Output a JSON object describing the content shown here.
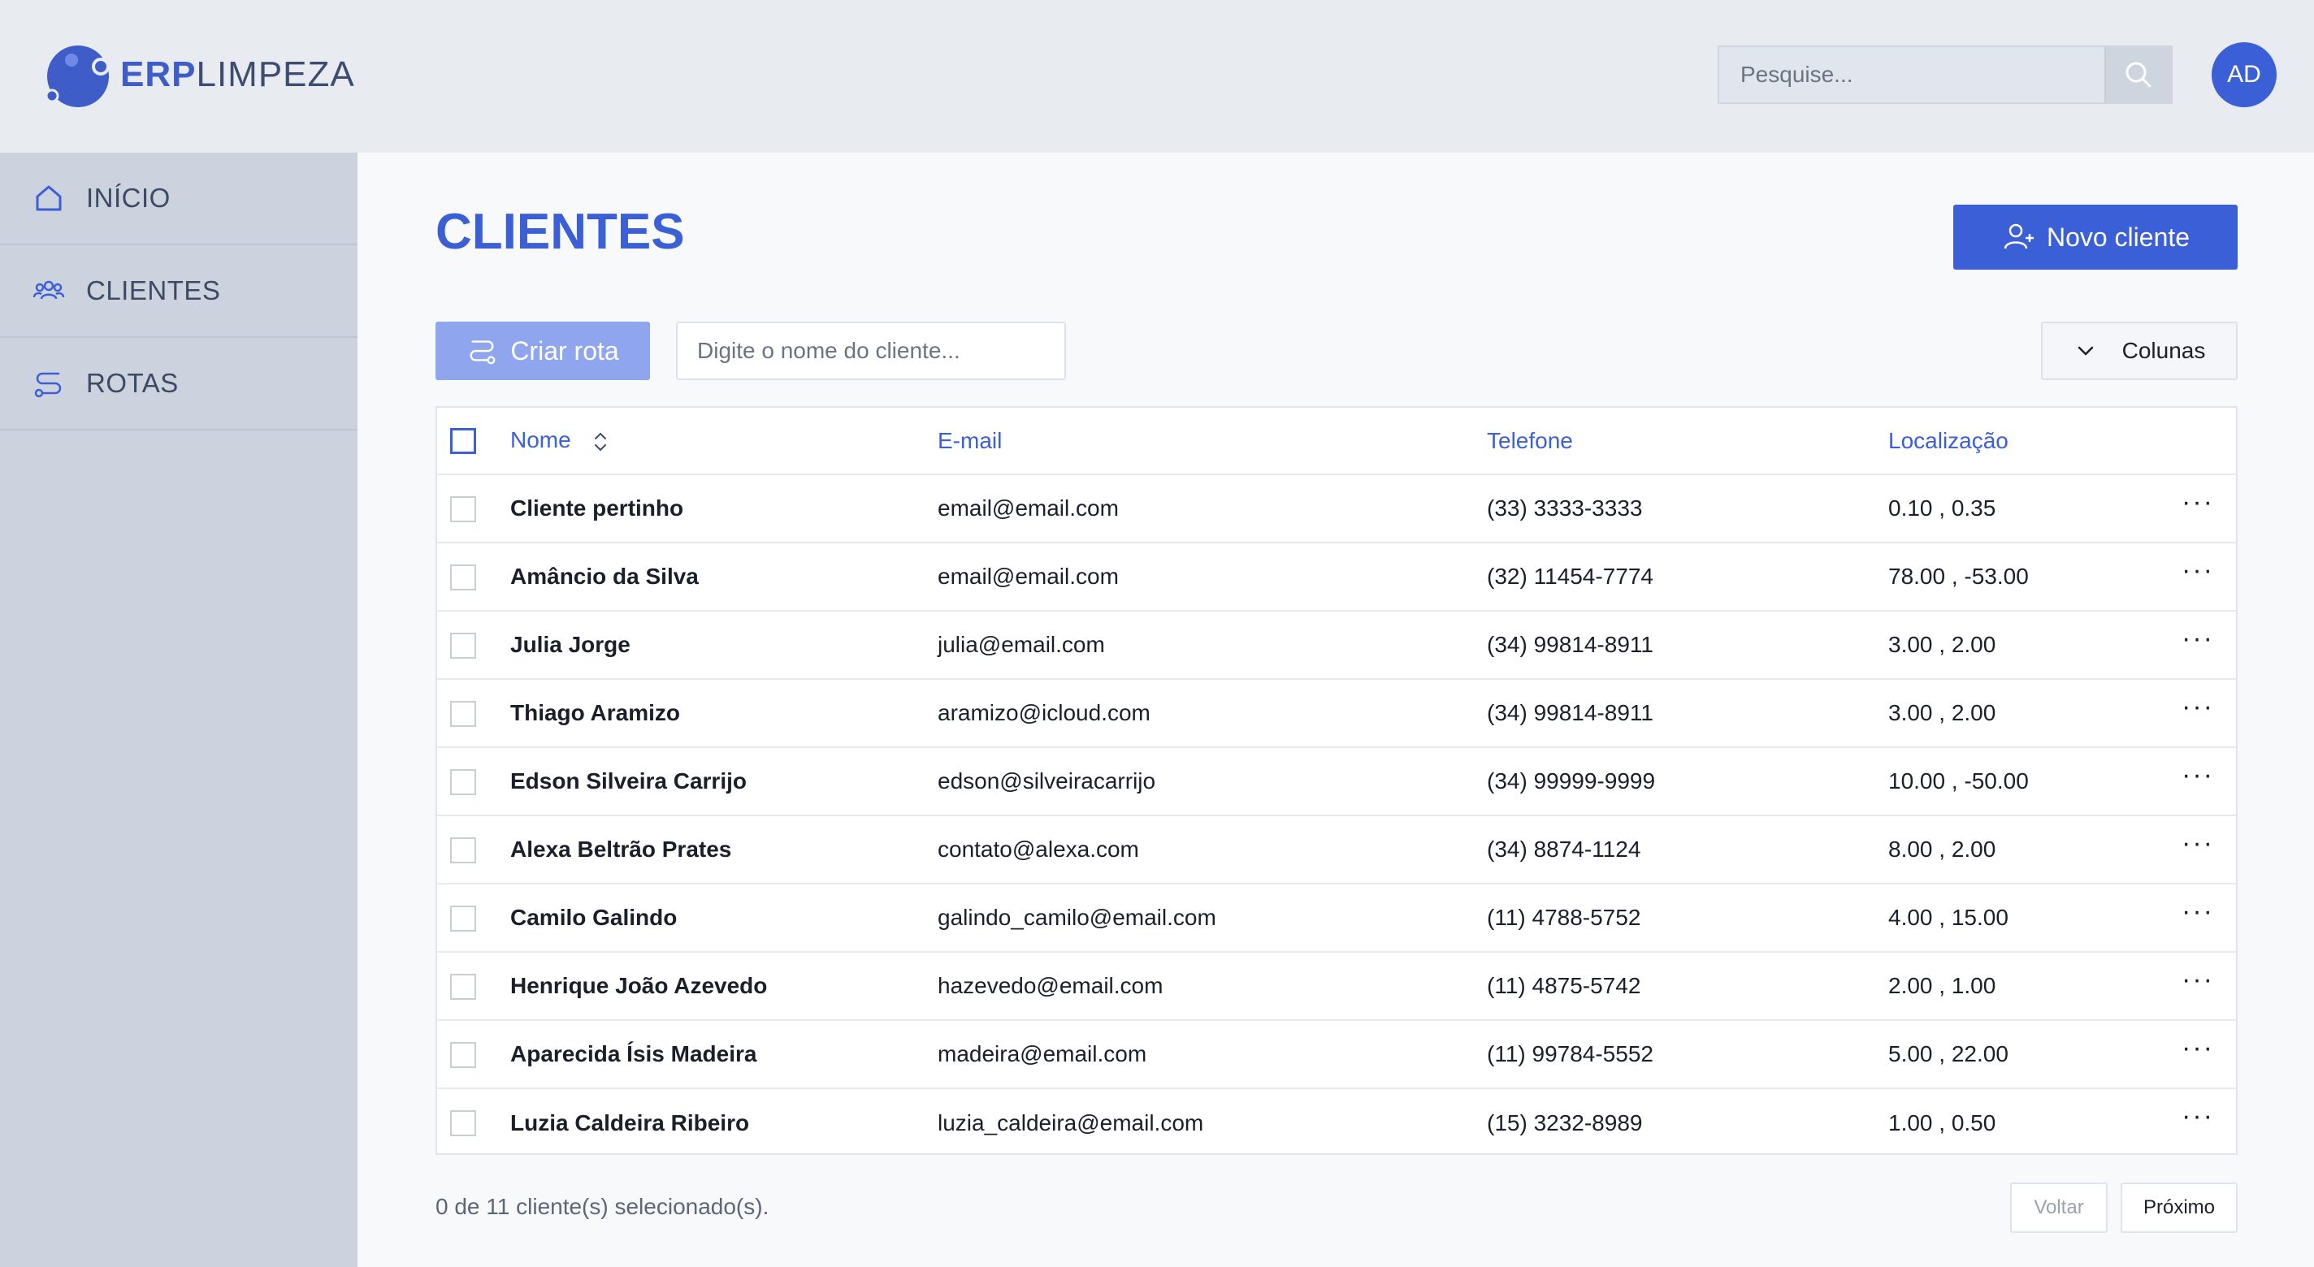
{
  "app": {
    "brand_bold": "ERP",
    "brand_light": "LIMPEZA"
  },
  "header": {
    "search_placeholder": "Pesquise...",
    "avatar_initials": "AD"
  },
  "sidebar": {
    "items": [
      {
        "label": "INÍCIO",
        "icon": "home-icon"
      },
      {
        "label": "CLIENTES",
        "icon": "users-icon"
      },
      {
        "label": "ROTAS",
        "icon": "route-icon"
      }
    ]
  },
  "main": {
    "title": "CLIENTES",
    "new_client_label": "Novo cliente",
    "create_route_label": "Criar rota",
    "filter_placeholder": "Digite o nome do cliente...",
    "columns_label": "Colunas"
  },
  "table": {
    "headers": {
      "name": "Nome",
      "email": "E-mail",
      "phone": "Telefone",
      "location": "Localização"
    },
    "rows": [
      {
        "name": "Cliente pertinho",
        "email": "email@email.com",
        "phone": "(33) 3333-3333",
        "location": "0.10 , 0.35"
      },
      {
        "name": "Amâncio da Silva",
        "email": "email@email.com",
        "phone": "(32) 11454-7774",
        "location": "78.00 , -53.00"
      },
      {
        "name": "Julia Jorge",
        "email": "julia@email.com",
        "phone": "(34) 99814-8911",
        "location": "3.00 , 2.00"
      },
      {
        "name": "Thiago Aramizo",
        "email": "aramizo@icloud.com",
        "phone": "(34) 99814-8911",
        "location": "3.00 , 2.00"
      },
      {
        "name": "Edson Silveira Carrijo",
        "email": "edson@silveiracarrijo",
        "phone": "(34) 99999-9999",
        "location": "10.00 , -50.00"
      },
      {
        "name": "Alexa Beltrão Prates",
        "email": "contato@alexa.com",
        "phone": "(34) 8874-1124",
        "location": "8.00 , 2.00"
      },
      {
        "name": "Camilo Galindo",
        "email": "galindo_camilo@email.com",
        "phone": "(11) 4788-5752",
        "location": "4.00 , 15.00"
      },
      {
        "name": "Henrique João Azevedo",
        "email": "hazevedo@email.com",
        "phone": "(11) 4875-5742",
        "location": "2.00 , 1.00"
      },
      {
        "name": "Aparecida Ísis Madeira",
        "email": "madeira@email.com",
        "phone": "(11) 99784-5552",
        "location": "5.00 , 22.00"
      },
      {
        "name": "Luzia Caldeira Ribeiro",
        "email": "luzia_caldeira@email.com",
        "phone": "(15) 3232-8989",
        "location": "1.00 , 0.50"
      }
    ],
    "row_actions_label": "···"
  },
  "footer": {
    "selection_text": "0 de 11 cliente(s) selecionado(s).",
    "prev_label": "Voltar",
    "next_label": "Próximo"
  },
  "colors": {
    "accent": "#3b5fd6",
    "accent_light": "#8fa6ee",
    "sidebar_bg": "#ccd3de",
    "header_bg": "#e8ecf1"
  }
}
